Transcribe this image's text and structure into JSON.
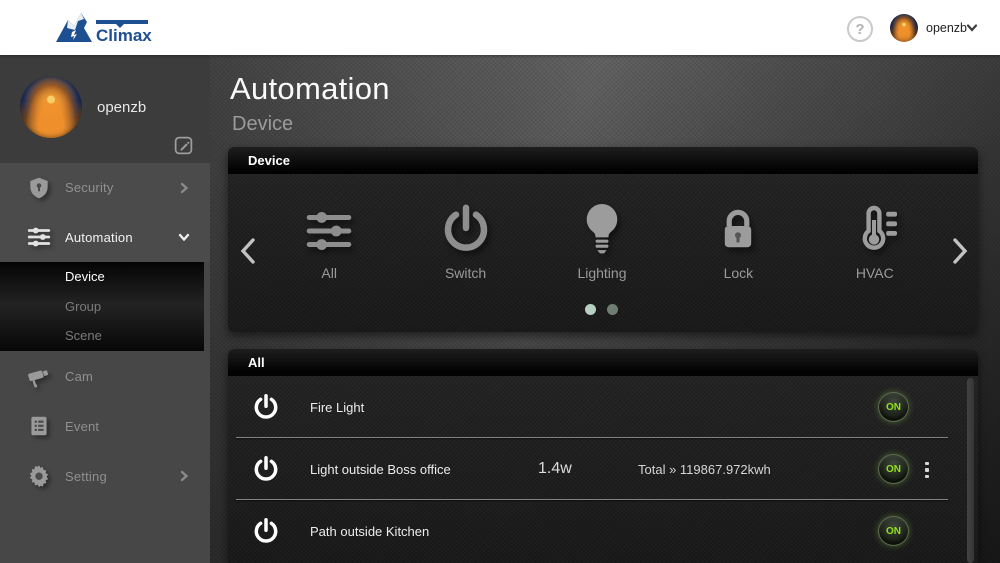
{
  "topbar": {
    "brand": "Climax",
    "help_label": "?",
    "user_name": "openzb"
  },
  "sidebar": {
    "user_name": "openzb",
    "items": [
      {
        "label": "Security",
        "icon": "shield-icon",
        "chevron": "right",
        "active": false
      },
      {
        "label": "Automation",
        "icon": "sliders-icon",
        "chevron": "down",
        "active": true
      }
    ],
    "submenu": [
      {
        "label": "Device",
        "active": true
      },
      {
        "label": "Group",
        "active": false
      },
      {
        "label": "Scene",
        "active": false
      }
    ],
    "items_lower": [
      {
        "label": "Cam",
        "icon": "camera-icon",
        "chevron": "none"
      },
      {
        "label": "Event",
        "icon": "event-list-icon",
        "chevron": "none"
      },
      {
        "label": "Setting",
        "icon": "gear-icon",
        "chevron": "right"
      }
    ]
  },
  "main": {
    "title": "Automation",
    "subtitle": "Device",
    "device_panel": {
      "header": "Device",
      "categories": [
        {
          "label": "All",
          "icon": "sliders-icon"
        },
        {
          "label": "Switch",
          "icon": "power-icon"
        },
        {
          "label": "Lighting",
          "icon": "bulb-icon"
        },
        {
          "label": "Lock",
          "icon": "lock-icon"
        },
        {
          "label": "HVAC",
          "icon": "thermometer-icon"
        }
      ],
      "pagination": {
        "dot_count": 2,
        "active_index": 0
      }
    },
    "list_panel": {
      "header": "All",
      "rows": [
        {
          "name": "Fire Light",
          "state": "ON"
        },
        {
          "name": "Light outside Boss office",
          "power": "1.4w",
          "total": "Total » 119867.972kwh",
          "state": "ON",
          "has_menu": true
        },
        {
          "name": "Path outside Kitchen",
          "state": "ON"
        }
      ]
    }
  },
  "colors": {
    "brand_blue": "#1d4f91",
    "accent_green": "#8ee21e",
    "dot_active": "#b7cfc0",
    "dot_inactive": "#6f7e73",
    "sidebar_bg": "#464646",
    "panel_header_bg": "#020202"
  }
}
